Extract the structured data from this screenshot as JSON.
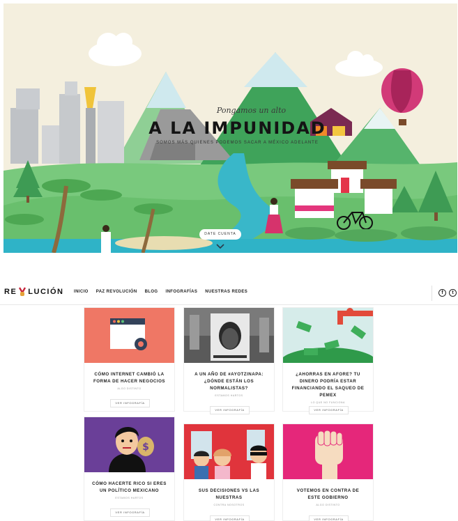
{
  "hero": {
    "kicker": "Pongamos un alto",
    "title": "A LA IMPUNIDAD",
    "subtitle": "SOMOS MÁS QUIENES PODEMOS SACAR A MÉXICO ADELANTE",
    "cta": "DATE CUENTA",
    "scroll_icon": "chevron-down-icon"
  },
  "nav": {
    "logo_left": "RE",
    "logo_right": "LUCIÓN",
    "logo_icon": "peace-hand-icon",
    "links": [
      "INICIO",
      "PAZ REVOLUCIÓN",
      "BLOG",
      "INFOGRAFÍAS",
      "NUESTRAS REDES"
    ],
    "social": [
      {
        "icon": "facebook-icon",
        "glyph": "f"
      },
      {
        "icon": "twitter-icon",
        "glyph": "t"
      }
    ]
  },
  "cards": [
    {
      "title": "CÓMO INTERNET CAMBIÓ LA FORMA DE HACER NEGOCIOS",
      "author": "ALGO DISTINTO",
      "button": "VER INFOGRAFÍA",
      "image_icon": "browser-gear-icon",
      "color": "#ef7765"
    },
    {
      "title": "A UN AÑO DE #AYOTZINAPA: ¿DÓNDE ESTÁN LOS NORMALISTAS?",
      "author": "ESTAMOS HARTOS",
      "button": "VER INFOGRAFÍA",
      "image_icon": "protest-photo",
      "color": "#6a6a6a"
    },
    {
      "title": "¿AHORRAS EN AFORE? TU DINERO PODRÍA ESTAR FINANCIANDO EL SAQUEO DE PEMEX",
      "author": "LO QUE NO FUNCIONA",
      "button": "VER INFOGRAFÍA",
      "image_icon": "money-pipe-icon",
      "color": "#d6ecea"
    },
    {
      "title": "CÓMO HACERTE RICO SI ERES UN POLÍTICO MEXICANO",
      "author": "ESTAMOS HARTOS",
      "button": "VER INFOGRAFÍA",
      "image_icon": "politician-money-icon",
      "color": "#6a3f98"
    },
    {
      "title": "SUS DECISIONES VS LAS NUESTRAS",
      "author": "CONTRA NOSOTROS",
      "button": "VER INFOGRAFÍA",
      "image_icon": "people-thief-icon",
      "color": "#e0343c"
    },
    {
      "title": "VOTEMOS EN CONTRA DE ESTE GOBIERNO",
      "author": "ALGO DISTINTO",
      "button": "VER INFOGRAFÍA",
      "image_icon": "raised-fist-icon",
      "color": "#e5277a"
    }
  ]
}
